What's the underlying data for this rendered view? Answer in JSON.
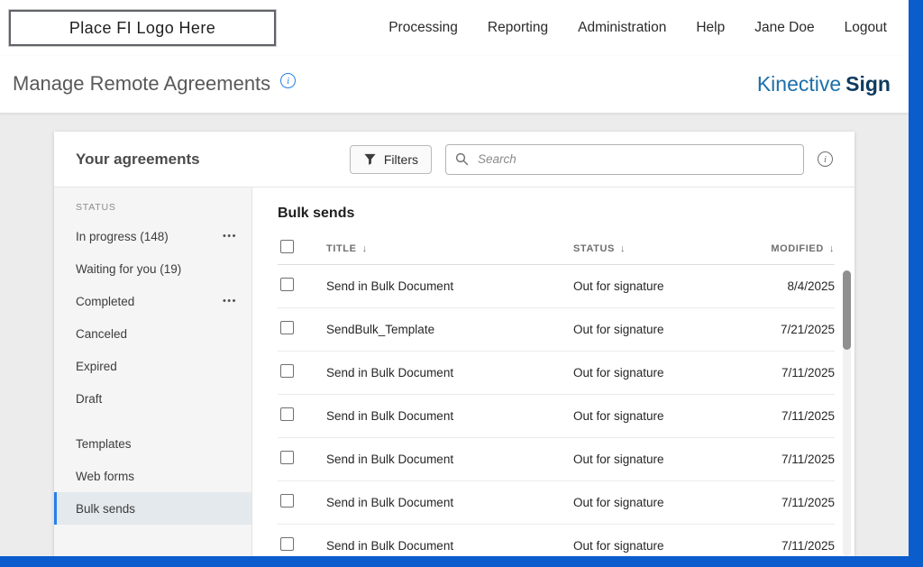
{
  "colors": {
    "frame_blue": "#0b5ccd",
    "selection_blue": "#2680eb",
    "brand_blue": "#1d6fa9",
    "brand_navy": "#0d3a5f"
  },
  "icons": {
    "info": "i",
    "ellipsis": "•••",
    "sort_desc": "↓"
  },
  "header": {
    "logo_text": "Place FI Logo Here",
    "nav": [
      {
        "label": "Processing"
      },
      {
        "label": "Reporting"
      },
      {
        "label": "Administration"
      },
      {
        "label": "Help"
      },
      {
        "label": "Jane Doe"
      },
      {
        "label": "Logout"
      }
    ]
  },
  "page": {
    "title": "Manage Remote Agreements",
    "brand_primary": "Kinective",
    "brand_secondary": "Sign"
  },
  "agreements": {
    "title": "Your agreements",
    "filters_label": "Filters",
    "search_placeholder": "Search",
    "sidebar": {
      "section_label": "STATUS",
      "items": [
        {
          "label": "In progress (148)"
        },
        {
          "label": "Waiting for you (19)"
        },
        {
          "label": "Completed"
        },
        {
          "label": "Canceled"
        },
        {
          "label": "Expired"
        },
        {
          "label": "Draft"
        },
        {
          "label": "Templates"
        },
        {
          "label": "Web forms"
        },
        {
          "label": "Bulk sends"
        }
      ]
    },
    "table": {
      "title": "Bulk sends",
      "columns": {
        "title": "TITLE",
        "status": "STATUS",
        "modified": "MODIFIED"
      },
      "rows": [
        {
          "title": "Send in Bulk Document",
          "status": "Out for signature",
          "modified": "8/4/2025"
        },
        {
          "title": "SendBulk_Template",
          "status": "Out for signature",
          "modified": "7/21/2025"
        },
        {
          "title": "Send in Bulk Document",
          "status": "Out for signature",
          "modified": "7/11/2025"
        },
        {
          "title": "Send in Bulk Document",
          "status": "Out for signature",
          "modified": "7/11/2025"
        },
        {
          "title": "Send in Bulk Document",
          "status": "Out for signature",
          "modified": "7/11/2025"
        },
        {
          "title": "Send in Bulk Document",
          "status": "Out for signature",
          "modified": "7/11/2025"
        },
        {
          "title": "Send in Bulk Document",
          "status": "Out for signature",
          "modified": "7/11/2025"
        }
      ]
    }
  }
}
